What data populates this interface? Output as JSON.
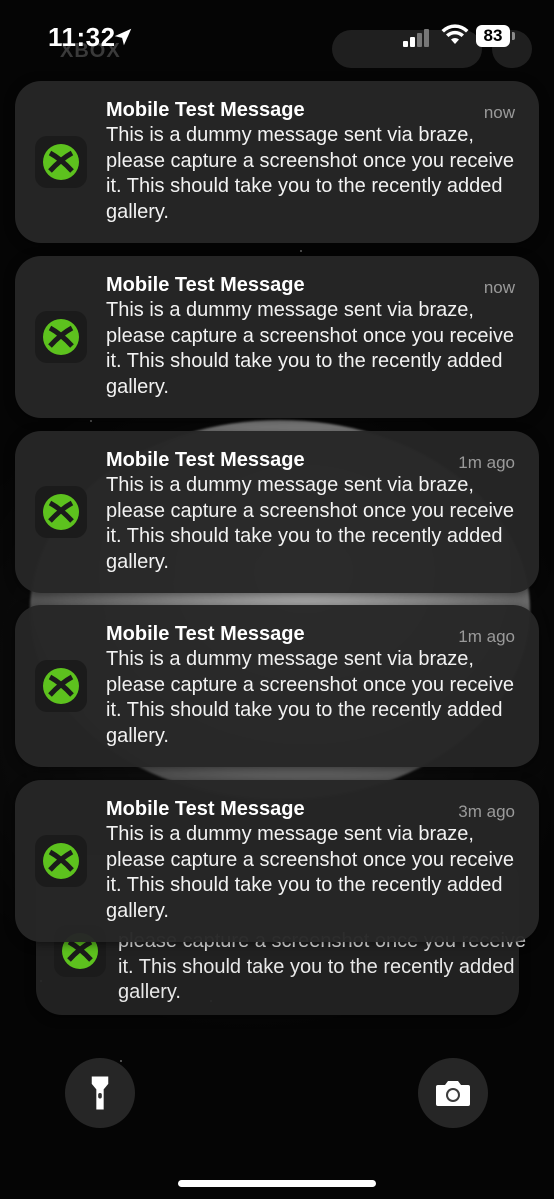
{
  "status_bar": {
    "time": "11:32",
    "battery": "83",
    "background_app": "XBOX"
  },
  "app": {
    "icon": "xbox-icon",
    "accent_color": "#5dc21e"
  },
  "notifications": [
    {
      "title": "Mobile Test Message",
      "time": "now",
      "body": "This is a dummy message sent via braze, please capture a screenshot once you receive it. This should take you to the recently added gallery."
    },
    {
      "title": "Mobile Test Message",
      "time": "now",
      "body": "This is a dummy message sent via braze, please capture a screenshot once you receive it. This should take you to the recently added gallery."
    },
    {
      "title": "Mobile Test Message",
      "time": "1m ago",
      "body": "This is a dummy message sent via braze, please capture a screenshot once you receive it. This should take you to the recently added gallery."
    },
    {
      "title": "Mobile Test Message",
      "time": "1m ago",
      "body": "This is a dummy message sent via braze, please capture a screenshot once you receive it. This should take you to the recently added gallery."
    },
    {
      "title": "Mobile Test Message",
      "time": "3m ago",
      "body": "This is a dummy message sent via braze, please capture a screenshot once you receive it. This should take you to the recently added gallery."
    }
  ],
  "stacked_notification": {
    "body_partial": "please capture a screenshot once you receive it. This should take you to the recently added gallery."
  },
  "controls": {
    "left": "flashlight-icon",
    "right": "camera-icon"
  }
}
